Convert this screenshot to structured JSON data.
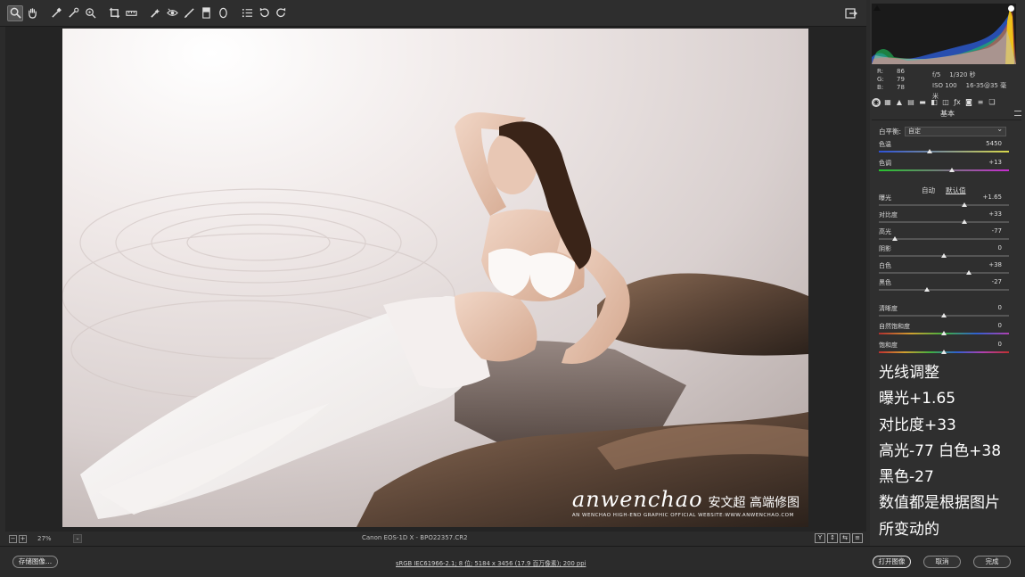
{
  "toolbar": {
    "tools": [
      "zoom-icon",
      "hand-icon",
      "white-balance-icon",
      "color-sampler-icon",
      "targeted-adjust-icon",
      "crop-icon",
      "straighten-icon",
      "spot-removal-icon",
      "red-eye-icon",
      "adjustment-brush-icon",
      "graduated-filter-icon",
      "radial-filter-icon",
      "presets-list-icon",
      "rotate-left-icon",
      "rotate-right-icon"
    ],
    "export_icon": "open-in-photoshop-icon"
  },
  "watermark": {
    "brand": "anwenchao",
    "cn": "安文超 高端修图",
    "sub": "AN WENCHAO HIGH-END GRAPHIC OFFICIAL WEBSITE:WWW.ANWENCHAO.COM"
  },
  "status": {
    "zoom": "27%",
    "file": "Canon EOS-1D X  -  BPO22357.CR2",
    "view_buttons": [
      "Y",
      "↕",
      "⇆",
      "≡"
    ]
  },
  "info": {
    "r_label": "R:",
    "r": "86",
    "g_label": "G:",
    "g": "79",
    "b_label": "B:",
    "b": "78",
    "aperture": "f/5",
    "shutter": "1/320 秒",
    "iso": "ISO 100",
    "lens": "16-35@35 毫米"
  },
  "panel": {
    "section_title": "基本",
    "wb_label": "白平衡:",
    "wb_value": "自定",
    "auto": "自动",
    "default": "默认值",
    "sliders": [
      {
        "label": "色温",
        "value": "5450",
        "pos": 0.39
      },
      {
        "label": "色调",
        "value": "+13",
        "pos": 0.56
      },
      {
        "label": "曝光",
        "value": "+1.65",
        "pos": 0.66
      },
      {
        "label": "对比度",
        "value": "+33",
        "pos": 0.66
      },
      {
        "label": "高光",
        "value": "-77",
        "pos": 0.12
      },
      {
        "label": "阴影",
        "value": "0",
        "pos": 0.5
      },
      {
        "label": "白色",
        "value": "+38",
        "pos": 0.69
      },
      {
        "label": "黑色",
        "value": "-27",
        "pos": 0.37
      },
      {
        "label": "清晰度",
        "value": "0",
        "pos": 0.5
      },
      {
        "label": "自然饱和度",
        "value": "0",
        "pos": 0.5
      },
      {
        "label": "饱和度",
        "value": "0",
        "pos": 0.5
      }
    ]
  },
  "notes": [
    "光线调整",
    "曝光+1.65",
    "对比度+33",
    "高光-77 白色+38",
    "黑色-27",
    "数值都是根据图片",
    "所变动的"
  ],
  "bottom": {
    "save": "存储图像...",
    "workflow": "sRGB IEC61966-2.1; 8 位; 5184 x 3456 (17.9 百万像素); 200 ppi",
    "open": "打开图像",
    "cancel": "取消",
    "done": "完成"
  }
}
